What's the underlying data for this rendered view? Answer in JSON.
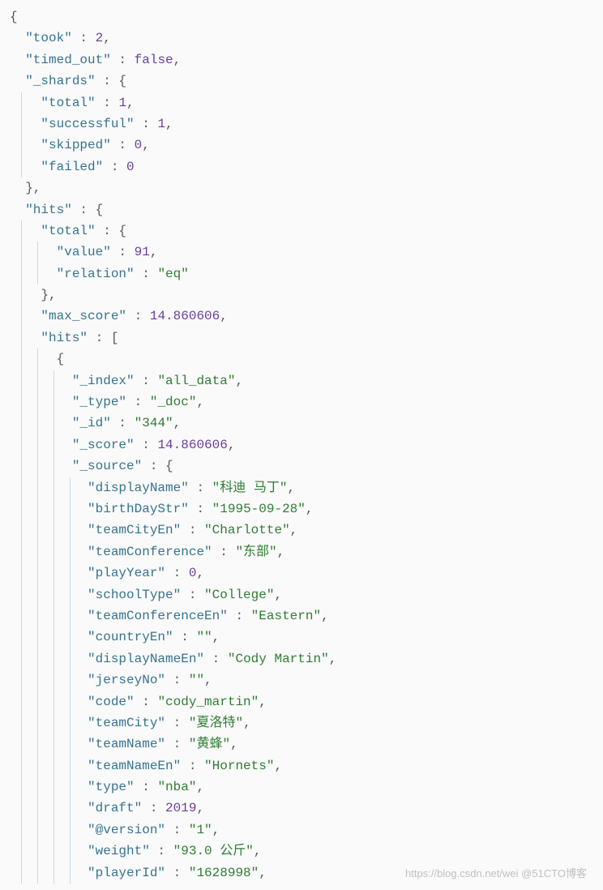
{
  "watermark": "https://blog.csdn.net/wei @51CTO博客",
  "colors": {
    "key": "#357390",
    "string": "#2e7d32",
    "number": "#6A3E9E",
    "bool": "#6A3E9E",
    "punct": "#5a5a5a",
    "guide": "#c7d9e8"
  },
  "json_response": {
    "took": 2,
    "timed_out": false,
    "_shards": {
      "total": 1,
      "successful": 1,
      "skipped": 0,
      "failed": 0
    },
    "hits": {
      "total": {
        "value": 91,
        "relation": "eq"
      },
      "max_score": 14.860606,
      "hits": [
        {
          "_index": "all_data",
          "_type": "_doc",
          "_id": "344",
          "_score": 14.860606,
          "_source": {
            "displayName": "科迪 马丁",
            "birthDayStr": "1995-09-28",
            "teamCityEn": "Charlotte",
            "teamConference": "东部",
            "playYear": 0,
            "schoolType": "College",
            "teamConferenceEn": "Eastern",
            "countryEn": "",
            "displayNameEn": "Cody Martin",
            "jerseyNo": "",
            "code": "cody_martin",
            "teamCity": "夏洛特",
            "teamName": "黄蜂",
            "teamNameEn": "Hornets",
            "type": "nba",
            "draft": 2019,
            "@version": "1",
            "weight": "93.0 公斤",
            "playerId": "1628998"
          }
        }
      ]
    }
  },
  "lines": [
    {
      "indent": 0,
      "guides": [],
      "tokens": [
        {
          "t": "{",
          "c": "punc"
        }
      ]
    },
    {
      "indent": 1,
      "guides": [],
      "tokens": [
        {
          "t": "\"took\"",
          "c": "key"
        },
        {
          "t": " : ",
          "c": "punc"
        },
        {
          "t": "2",
          "c": "num"
        },
        {
          "t": ",",
          "c": "punc"
        }
      ]
    },
    {
      "indent": 1,
      "guides": [],
      "tokens": [
        {
          "t": "\"timed_out\"",
          "c": "key"
        },
        {
          "t": " : ",
          "c": "punc"
        },
        {
          "t": "false",
          "c": "bool"
        },
        {
          "t": ",",
          "c": "punc"
        }
      ]
    },
    {
      "indent": 1,
      "guides": [],
      "tokens": [
        {
          "t": "\"_shards\"",
          "c": "key"
        },
        {
          "t": " : {",
          "c": "punc"
        }
      ]
    },
    {
      "indent": 2,
      "guides": [
        1
      ],
      "tokens": [
        {
          "t": "\"total\"",
          "c": "key"
        },
        {
          "t": " : ",
          "c": "punc"
        },
        {
          "t": "1",
          "c": "num"
        },
        {
          "t": ",",
          "c": "punc"
        }
      ]
    },
    {
      "indent": 2,
      "guides": [
        1
      ],
      "tokens": [
        {
          "t": "\"successful\"",
          "c": "key"
        },
        {
          "t": " : ",
          "c": "punc"
        },
        {
          "t": "1",
          "c": "num"
        },
        {
          "t": ",",
          "c": "punc"
        }
      ]
    },
    {
      "indent": 2,
      "guides": [
        1
      ],
      "tokens": [
        {
          "t": "\"skipped\"",
          "c": "key"
        },
        {
          "t": " : ",
          "c": "punc"
        },
        {
          "t": "0",
          "c": "num"
        },
        {
          "t": ",",
          "c": "punc"
        }
      ]
    },
    {
      "indent": 2,
      "guides": [
        1
      ],
      "tokens": [
        {
          "t": "\"failed\"",
          "c": "key"
        },
        {
          "t": " : ",
          "c": "punc"
        },
        {
          "t": "0",
          "c": "num"
        }
      ]
    },
    {
      "indent": 1,
      "guides": [],
      "tokens": [
        {
          "t": "},",
          "c": "punc"
        }
      ]
    },
    {
      "indent": 1,
      "guides": [],
      "tokens": [
        {
          "t": "\"hits\"",
          "c": "key"
        },
        {
          "t": " : {",
          "c": "punc"
        }
      ]
    },
    {
      "indent": 2,
      "guides": [
        1
      ],
      "tokens": [
        {
          "t": "\"total\"",
          "c": "key"
        },
        {
          "t": " : {",
          "c": "punc"
        }
      ]
    },
    {
      "indent": 3,
      "guides": [
        1,
        2
      ],
      "tokens": [
        {
          "t": "\"value\"",
          "c": "key"
        },
        {
          "t": " : ",
          "c": "punc"
        },
        {
          "t": "91",
          "c": "num"
        },
        {
          "t": ",",
          "c": "punc"
        }
      ]
    },
    {
      "indent": 3,
      "guides": [
        1,
        2
      ],
      "tokens": [
        {
          "t": "\"relation\"",
          "c": "key"
        },
        {
          "t": " : ",
          "c": "punc"
        },
        {
          "t": "\"eq\"",
          "c": "str"
        }
      ]
    },
    {
      "indent": 2,
      "guides": [
        1
      ],
      "tokens": [
        {
          "t": "},",
          "c": "punc"
        }
      ]
    },
    {
      "indent": 2,
      "guides": [
        1
      ],
      "tokens": [
        {
          "t": "\"max_score\"",
          "c": "key"
        },
        {
          "t": " : ",
          "c": "punc"
        },
        {
          "t": "14.860606",
          "c": "num"
        },
        {
          "t": ",",
          "c": "punc"
        }
      ]
    },
    {
      "indent": 2,
      "guides": [
        1
      ],
      "tokens": [
        {
          "t": "\"hits\"",
          "c": "key"
        },
        {
          "t": " : [",
          "c": "punc"
        }
      ]
    },
    {
      "indent": 3,
      "guides": [
        1,
        2
      ],
      "tokens": [
        {
          "t": "{",
          "c": "punc"
        }
      ]
    },
    {
      "indent": 4,
      "guides": [
        1,
        2,
        3
      ],
      "tokens": [
        {
          "t": "\"_index\"",
          "c": "key"
        },
        {
          "t": " : ",
          "c": "punc"
        },
        {
          "t": "\"all_data\"",
          "c": "str"
        },
        {
          "t": ",",
          "c": "punc"
        }
      ]
    },
    {
      "indent": 4,
      "guides": [
        1,
        2,
        3
      ],
      "tokens": [
        {
          "t": "\"_type\"",
          "c": "key"
        },
        {
          "t": " : ",
          "c": "punc"
        },
        {
          "t": "\"_doc\"",
          "c": "str"
        },
        {
          "t": ",",
          "c": "punc"
        }
      ]
    },
    {
      "indent": 4,
      "guides": [
        1,
        2,
        3
      ],
      "tokens": [
        {
          "t": "\"_id\"",
          "c": "key"
        },
        {
          "t": " : ",
          "c": "punc"
        },
        {
          "t": "\"344\"",
          "c": "str"
        },
        {
          "t": ",",
          "c": "punc"
        }
      ]
    },
    {
      "indent": 4,
      "guides": [
        1,
        2,
        3
      ],
      "tokens": [
        {
          "t": "\"_score\"",
          "c": "key"
        },
        {
          "t": " : ",
          "c": "punc"
        },
        {
          "t": "14.860606",
          "c": "num"
        },
        {
          "t": ",",
          "c": "punc"
        }
      ]
    },
    {
      "indent": 4,
      "guides": [
        1,
        2,
        3
      ],
      "tokens": [
        {
          "t": "\"_source\"",
          "c": "key"
        },
        {
          "t": " : {",
          "c": "punc"
        }
      ]
    },
    {
      "indent": 5,
      "guides": [
        1,
        2,
        3,
        4
      ],
      "tokens": [
        {
          "t": "\"displayName\"",
          "c": "key"
        },
        {
          "t": " : ",
          "c": "punc"
        },
        {
          "t": "\"科迪 马丁\"",
          "c": "str"
        },
        {
          "t": ",",
          "c": "punc"
        }
      ]
    },
    {
      "indent": 5,
      "guides": [
        1,
        2,
        3,
        4
      ],
      "tokens": [
        {
          "t": "\"birthDayStr\"",
          "c": "key"
        },
        {
          "t": " : ",
          "c": "punc"
        },
        {
          "t": "\"1995-09-28\"",
          "c": "str"
        },
        {
          "t": ",",
          "c": "punc"
        }
      ]
    },
    {
      "indent": 5,
      "guides": [
        1,
        2,
        3,
        4
      ],
      "tokens": [
        {
          "t": "\"teamCityEn\"",
          "c": "key"
        },
        {
          "t": " : ",
          "c": "punc"
        },
        {
          "t": "\"Charlotte\"",
          "c": "str"
        },
        {
          "t": ",",
          "c": "punc"
        }
      ]
    },
    {
      "indent": 5,
      "guides": [
        1,
        2,
        3,
        4
      ],
      "tokens": [
        {
          "t": "\"teamConference\"",
          "c": "key"
        },
        {
          "t": " : ",
          "c": "punc"
        },
        {
          "t": "\"东部\"",
          "c": "str"
        },
        {
          "t": ",",
          "c": "punc"
        }
      ]
    },
    {
      "indent": 5,
      "guides": [
        1,
        2,
        3,
        4
      ],
      "tokens": [
        {
          "t": "\"playYear\"",
          "c": "key"
        },
        {
          "t": " : ",
          "c": "punc"
        },
        {
          "t": "0",
          "c": "num"
        },
        {
          "t": ",",
          "c": "punc"
        }
      ]
    },
    {
      "indent": 5,
      "guides": [
        1,
        2,
        3,
        4
      ],
      "tokens": [
        {
          "t": "\"schoolType\"",
          "c": "key"
        },
        {
          "t": " : ",
          "c": "punc"
        },
        {
          "t": "\"College\"",
          "c": "str"
        },
        {
          "t": ",",
          "c": "punc"
        }
      ]
    },
    {
      "indent": 5,
      "guides": [
        1,
        2,
        3,
        4
      ],
      "tokens": [
        {
          "t": "\"teamConferenceEn\"",
          "c": "key"
        },
        {
          "t": " : ",
          "c": "punc"
        },
        {
          "t": "\"Eastern\"",
          "c": "str"
        },
        {
          "t": ",",
          "c": "punc"
        }
      ]
    },
    {
      "indent": 5,
      "guides": [
        1,
        2,
        3,
        4
      ],
      "tokens": [
        {
          "t": "\"countryEn\"",
          "c": "key"
        },
        {
          "t": " : ",
          "c": "punc"
        },
        {
          "t": "\"\"",
          "c": "str"
        },
        {
          "t": ",",
          "c": "punc"
        }
      ]
    },
    {
      "indent": 5,
      "guides": [
        1,
        2,
        3,
        4
      ],
      "tokens": [
        {
          "t": "\"displayNameEn\"",
          "c": "key"
        },
        {
          "t": " : ",
          "c": "punc"
        },
        {
          "t": "\"Cody Martin\"",
          "c": "str"
        },
        {
          "t": ",",
          "c": "punc"
        }
      ]
    },
    {
      "indent": 5,
      "guides": [
        1,
        2,
        3,
        4
      ],
      "tokens": [
        {
          "t": "\"jerseyNo\"",
          "c": "key"
        },
        {
          "t": " : ",
          "c": "punc"
        },
        {
          "t": "\"\"",
          "c": "str"
        },
        {
          "t": ",",
          "c": "punc"
        }
      ]
    },
    {
      "indent": 5,
      "guides": [
        1,
        2,
        3,
        4
      ],
      "tokens": [
        {
          "t": "\"code\"",
          "c": "key"
        },
        {
          "t": " : ",
          "c": "punc"
        },
        {
          "t": "\"cody_martin\"",
          "c": "str"
        },
        {
          "t": ",",
          "c": "punc"
        }
      ]
    },
    {
      "indent": 5,
      "guides": [
        1,
        2,
        3,
        4
      ],
      "tokens": [
        {
          "t": "\"teamCity\"",
          "c": "key"
        },
        {
          "t": " : ",
          "c": "punc"
        },
        {
          "t": "\"夏洛特\"",
          "c": "str"
        },
        {
          "t": ",",
          "c": "punc"
        }
      ]
    },
    {
      "indent": 5,
      "guides": [
        1,
        2,
        3,
        4
      ],
      "tokens": [
        {
          "t": "\"teamName\"",
          "c": "key"
        },
        {
          "t": " : ",
          "c": "punc"
        },
        {
          "t": "\"黄蜂\"",
          "c": "str"
        },
        {
          "t": ",",
          "c": "punc"
        }
      ]
    },
    {
      "indent": 5,
      "guides": [
        1,
        2,
        3,
        4
      ],
      "tokens": [
        {
          "t": "\"teamNameEn\"",
          "c": "key"
        },
        {
          "t": " : ",
          "c": "punc"
        },
        {
          "t": "\"Hornets\"",
          "c": "str"
        },
        {
          "t": ",",
          "c": "punc"
        }
      ]
    },
    {
      "indent": 5,
      "guides": [
        1,
        2,
        3,
        4
      ],
      "tokens": [
        {
          "t": "\"type\"",
          "c": "key"
        },
        {
          "t": " : ",
          "c": "punc"
        },
        {
          "t": "\"nba\"",
          "c": "str"
        },
        {
          "t": ",",
          "c": "punc"
        }
      ]
    },
    {
      "indent": 5,
      "guides": [
        1,
        2,
        3,
        4
      ],
      "tokens": [
        {
          "t": "\"draft\"",
          "c": "key"
        },
        {
          "t": " : ",
          "c": "punc"
        },
        {
          "t": "2019",
          "c": "num"
        },
        {
          "t": ",",
          "c": "punc"
        }
      ]
    },
    {
      "indent": 5,
      "guides": [
        1,
        2,
        3,
        4
      ],
      "tokens": [
        {
          "t": "\"@version\"",
          "c": "key"
        },
        {
          "t": " : ",
          "c": "punc"
        },
        {
          "t": "\"1\"",
          "c": "str"
        },
        {
          "t": ",",
          "c": "punc"
        }
      ]
    },
    {
      "indent": 5,
      "guides": [
        1,
        2,
        3,
        4
      ],
      "tokens": [
        {
          "t": "\"weight\"",
          "c": "key"
        },
        {
          "t": " : ",
          "c": "punc"
        },
        {
          "t": "\"93.0 公斤\"",
          "c": "str"
        },
        {
          "t": ",",
          "c": "punc"
        }
      ]
    },
    {
      "indent": 5,
      "guides": [
        1,
        2,
        3,
        4
      ],
      "tokens": [
        {
          "t": "\"playerId\"",
          "c": "key"
        },
        {
          "t": " : ",
          "c": "punc"
        },
        {
          "t": "\"1628998\"",
          "c": "str"
        },
        {
          "t": ",",
          "c": "punc"
        }
      ]
    }
  ]
}
